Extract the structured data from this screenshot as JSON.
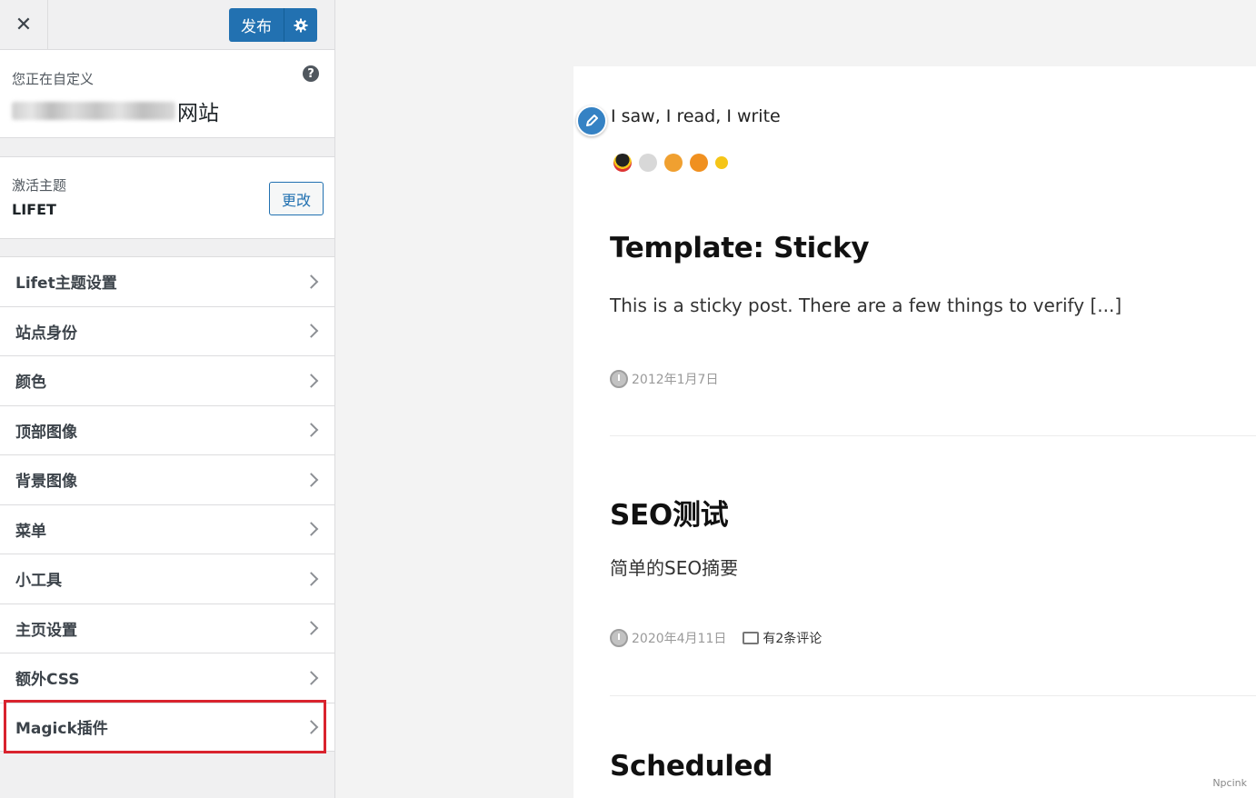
{
  "topbar": {
    "close_label": "✕",
    "publish_label": "发布"
  },
  "info": {
    "label": "您正在自定义",
    "site_suffix": "网站"
  },
  "theme": {
    "label": "激活主题",
    "name": "LIFET",
    "change_label": "更改"
  },
  "menu": {
    "items": [
      {
        "label": "Lifet主题设置"
      },
      {
        "label": "站点身份"
      },
      {
        "label": "颜色"
      },
      {
        "label": "顶部图像"
      },
      {
        "label": "背景图像"
      },
      {
        "label": "菜单"
      },
      {
        "label": "小工具"
      },
      {
        "label": "主页设置"
      },
      {
        "label": "额外CSS"
      },
      {
        "label": "Magick插件"
      }
    ]
  },
  "preview": {
    "tagline": "I saw, I read, I write",
    "social_icons": [
      "qq-icon",
      "wechat-icon",
      "mail-icon",
      "weibo-icon",
      "rss-icon"
    ],
    "posts": [
      {
        "title": "Template: Sticky",
        "excerpt": "This is a sticky post. There are a few things to verify [...]",
        "date": "2012年1月7日",
        "comments": ""
      },
      {
        "title": "SEO测试",
        "excerpt": "简单的SEO摘要",
        "date": "2020年4月11日",
        "comments": "有2条评论"
      },
      {
        "title": "Scheduled",
        "excerpt": "",
        "date": "",
        "comments": ""
      }
    ]
  },
  "watermark": "Npcink",
  "colors": {
    "primary": "#2271b1",
    "highlight": "#d9232e"
  }
}
